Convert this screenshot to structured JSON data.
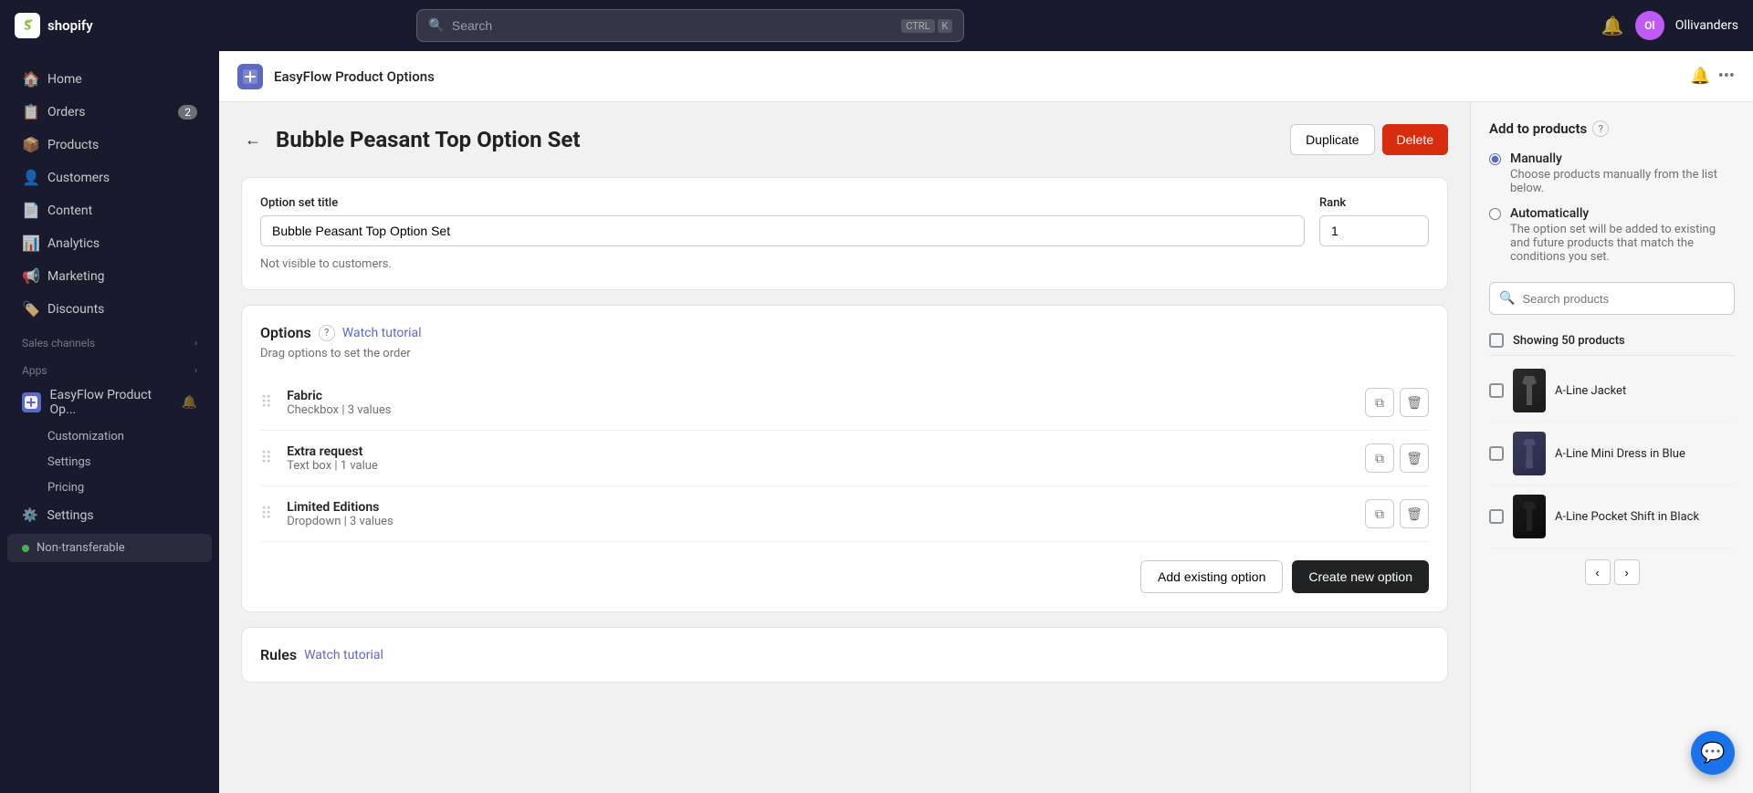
{
  "topNav": {
    "logoText": "shopify",
    "search": {
      "placeholder": "Search",
      "shortcutKey1": "CTRL",
      "shortcutKey2": "K"
    },
    "storeName": "Ollivanders",
    "avatarInitials": "Ol"
  },
  "sidebar": {
    "items": [
      {
        "id": "home",
        "label": "Home",
        "icon": "🏠",
        "badge": null
      },
      {
        "id": "orders",
        "label": "Orders",
        "icon": "📋",
        "badge": "2"
      },
      {
        "id": "products",
        "label": "Products",
        "icon": "📦",
        "badge": null
      },
      {
        "id": "customers",
        "label": "Customers",
        "icon": "👤",
        "badge": null
      },
      {
        "id": "content",
        "label": "Content",
        "icon": "📄",
        "badge": null
      },
      {
        "id": "analytics",
        "label": "Analytics",
        "icon": "📊",
        "badge": null
      },
      {
        "id": "marketing",
        "label": "Marketing",
        "icon": "📢",
        "badge": null
      },
      {
        "id": "discounts",
        "label": "Discounts",
        "icon": "🏷️",
        "badge": null
      }
    ],
    "salesChannelsLabel": "Sales channels",
    "appsLabel": "Apps",
    "appName": "EasyFlow Product Op...",
    "subItems": [
      "Customization",
      "Settings",
      "Pricing"
    ],
    "settingsLabel": "Settings",
    "nonTransferableLabel": "Non-transferable"
  },
  "appBar": {
    "title": "EasyFlow Product Options"
  },
  "page": {
    "title": "Bubble Peasant Top Option Set",
    "backLabel": "←",
    "duplicateLabel": "Duplicate",
    "deleteLabel": "Delete"
  },
  "optionSetForm": {
    "titleLabel": "Option set title",
    "titleValue": "Bubble Peasant Top Option Set",
    "rankLabel": "Rank",
    "rankValue": "1",
    "hint": "Not visible to customers."
  },
  "optionsSection": {
    "title": "Options",
    "helpTooltip": "?",
    "watchTutorialLabel": "Watch tutorial",
    "dragHint": "Drag options to set the order",
    "options": [
      {
        "name": "Fabric",
        "meta": "Checkbox | 3 values"
      },
      {
        "name": "Extra request",
        "meta": "Text box | 1 value"
      },
      {
        "name": "Limited Editions",
        "meta": "Dropdown | 3 values"
      }
    ],
    "addExistingLabel": "Add existing option",
    "createNewLabel": "Create new option"
  },
  "rulesSection": {
    "title": "Rules",
    "watchTutorialLabel": "Watch tutorial"
  },
  "addToProducts": {
    "title": "Add to products",
    "helpTooltip": "?",
    "manuallyLabel": "Manually",
    "manuallyDesc": "Choose products manually from the list below.",
    "automaticallyLabel": "Automatically",
    "automaticallyDesc": "The option set will be added to existing and future products that match the conditions you set.",
    "searchPlaceholder": "Search products",
    "showingLabel": "Showing 50 products",
    "products": [
      {
        "name": "A-Line Jacket",
        "imgClass": "product-img-a-line-jacket"
      },
      {
        "name": "A-Line Mini Dress in Blue",
        "imgClass": "product-img-a-line-mini"
      },
      {
        "name": "A-Line Pocket Shift in Black",
        "imgClass": "product-img-a-line-pocket"
      }
    ]
  },
  "pagination": {
    "prevLabel": "‹",
    "nextLabel": "›"
  },
  "chat": {
    "icon": "💬"
  }
}
